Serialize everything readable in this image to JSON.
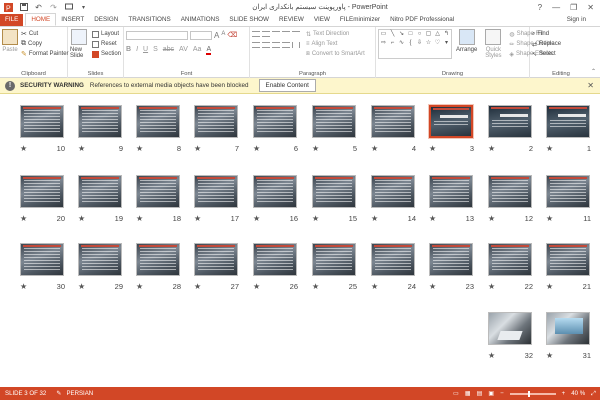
{
  "titlebar": {
    "title": "پاورپوینت سیستم بانکداری ایران - PowerPoint",
    "help": "?",
    "min": "—",
    "max": "❐",
    "close": "✕"
  },
  "tabs": {
    "file": "FILE",
    "items": [
      "HOME",
      "INSERT",
      "DESIGN",
      "TRANSITIONS",
      "ANIMATIONS",
      "SLIDE SHOW",
      "REVIEW",
      "VIEW",
      "FILEminimizer",
      "Nitro PDF Professional"
    ],
    "signin": "Sign in"
  },
  "ribbon": {
    "clipboard": {
      "paste": "Paste",
      "cut": "Cut",
      "copy": "Copy",
      "format_painter": "Format Painter",
      "label": "Clipboard"
    },
    "slides": {
      "new_slide": "New Slide",
      "layout": "Layout",
      "reset": "Reset",
      "section": "Section",
      "label": "Slides"
    },
    "font": {
      "label": "Font",
      "bold": "B",
      "italic": "I",
      "underline": "U",
      "shadow": "S",
      "strike": "abc",
      "spacing": "AV",
      "case": "Aa",
      "grow": "A",
      "shrink": "A"
    },
    "paragraph": {
      "text_direction": "Text Direction",
      "align_text": "Align Text",
      "convert_smartart": "Convert to SmartArt",
      "label": "Paragraph"
    },
    "drawing": {
      "arrange": "Arrange",
      "quick_styles": "Quick Styles",
      "shape_fill": "Shape Fill",
      "shape_outline": "Shape Outline",
      "shape_effects": "Shape Effects",
      "label": "Drawing"
    },
    "editing": {
      "find": "Find",
      "replace": "Replace",
      "select": "Select",
      "label": "Editing"
    }
  },
  "security": {
    "title": "SECURITY WARNING",
    "message": "References to external media objects have been blocked",
    "button": "Enable Content",
    "close": "✕"
  },
  "slides": {
    "row1": [
      10,
      9,
      8,
      7,
      6,
      5,
      4,
      3,
      2,
      1
    ],
    "row2": [
      20,
      19,
      18,
      17,
      16,
      15,
      14,
      13,
      12,
      11
    ],
    "row3": [
      30,
      29,
      28,
      27,
      26,
      25,
      24,
      23,
      22,
      21
    ],
    "row4": [
      32,
      31
    ],
    "selected": 3,
    "star": "★"
  },
  "status": {
    "slide": "SLIDE 3 OF 32",
    "language": "PERSIAN",
    "zoom": "40 %",
    "zoom_fraction": 0.4
  },
  "colors": {
    "accent": "#d24726",
    "warning_bg": "#fdf6cc"
  }
}
